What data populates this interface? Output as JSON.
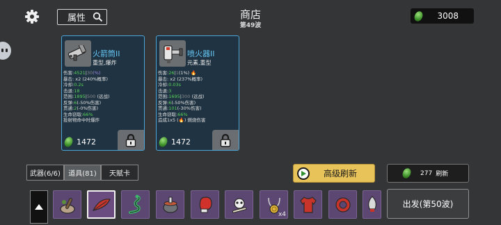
{
  "header": {
    "attributes_label": "属性",
    "shop_title": "商店",
    "wave_label": "第49波",
    "currency_amount": "3008"
  },
  "cards": [
    {
      "name": "火箭筒II",
      "tags": "重型,爆炸",
      "stats": [
        {
          "label": "伤害",
          "value": "4521",
          "extra": "30",
          "note": "(%)"
        },
        {
          "label": "暴击",
          "value": "x2",
          "extra": "(240%概率)"
        },
        {
          "label": "冷却",
          "value": "0.2s"
        },
        {
          "label": "击退",
          "value": "18"
        },
        {
          "label": "范围",
          "value": "1895",
          "extra": "500",
          "note": "(远战)"
        },
        {
          "label": "反弹",
          "value": "6",
          "extra": "(-50%伤害)"
        },
        {
          "label": "贯通",
          "value": "2",
          "extra": "(-0%伤害)"
        },
        {
          "label": "生命窃取",
          "value": "66%"
        }
      ],
      "description": "投射物命中时爆炸",
      "price": "1472"
    },
    {
      "name": "喷火器II",
      "tags": "元素,重型",
      "stats": [
        {
          "label": "伤害",
          "value": "26",
          "extra": "1",
          "note": "(1%)"
        },
        {
          "label": "暴击",
          "value": "x2",
          "extra": "(237%概率)"
        },
        {
          "label": "冷却",
          "value": "0.03s"
        },
        {
          "label": "击退",
          "value": "3"
        },
        {
          "label": "范围",
          "value": "1695",
          "extra": "300",
          "note": "(远战)"
        },
        {
          "label": "反弹",
          "value": "6",
          "extra": "(-50%伤害)"
        },
        {
          "label": "贯通",
          "value": "101",
          "extra": "(-30%伤害)"
        },
        {
          "label": "生命窃取",
          "value": "66%"
        }
      ],
      "description_prefix": "造成1x5 (",
      "description_suffix": ") 燃烧伤害",
      "price": "1472"
    }
  ],
  "tabs": [
    "武器(6/6)",
    "道具(81)",
    "天赋卡"
  ],
  "advanced_refresh_label": "高级刷新",
  "refresh": {
    "cost": "277",
    "label": "刷新"
  },
  "items": [
    {
      "icon": "mortar-pestle-icon"
    },
    {
      "icon": "red-feather-icon"
    },
    {
      "icon": "green-snake-icon"
    },
    {
      "icon": "cooking-pot-icon"
    },
    {
      "icon": "boxing-glove-icon"
    },
    {
      "icon": "bone-skull-icon"
    },
    {
      "icon": "coin-necklace-icon",
      "count": "x4"
    },
    {
      "icon": "red-shirt-icon"
    },
    {
      "icon": "red-ring-icon"
    },
    {
      "icon": "rocket-icon"
    }
  ],
  "depart_label": "出发(第50波)",
  "colors": {
    "background": "#333536",
    "card_bg": "#1f3342",
    "card_border": "#4aa6d8",
    "name_blue": "#67c7f5",
    "value_green": "#59d159",
    "advanced_button": "#e8c35a",
    "item_slot": "#5c4672"
  }
}
